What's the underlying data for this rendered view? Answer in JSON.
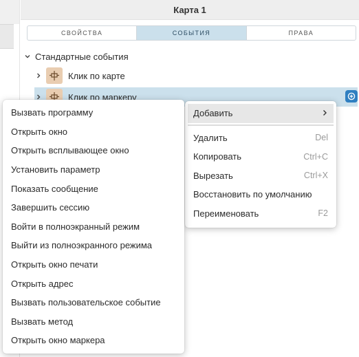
{
  "panel": {
    "title": "Карта 1",
    "tabs": [
      {
        "label": "Свойства",
        "active": false
      },
      {
        "label": "События",
        "active": true
      },
      {
        "label": "Права",
        "active": false
      }
    ]
  },
  "tree": {
    "group_label": "Стандартные события",
    "items": [
      {
        "label": "Клик по карте",
        "selected": false,
        "icon": "event-block-icon"
      },
      {
        "label": "Клик по маркеру",
        "selected": true,
        "icon": "event-block-icon"
      }
    ]
  },
  "context_menu": {
    "items": [
      {
        "label": "Добавить",
        "shortcut": "",
        "has_submenu": true
      },
      {
        "label": "Удалить",
        "shortcut": "Del"
      },
      {
        "label": "Копировать",
        "shortcut": "Ctrl+C"
      },
      {
        "label": "Вырезать",
        "shortcut": "Ctrl+X"
      },
      {
        "label": "Восстановить по умолчанию",
        "shortcut": ""
      },
      {
        "label": "Переименовать",
        "shortcut": "F2"
      }
    ]
  },
  "submenu": {
    "items": [
      "Вызвать программу",
      "Открыть окно",
      "Открыть всплывающее окно",
      "Установить параметр",
      "Показать сообщение",
      "Завершить сессию",
      "Войти в полноэкранный режим",
      "Выйти из полноэкранного режима",
      "Открыть окно печати",
      "Открыть адрес",
      "Вызвать пользовательское событие",
      "Вызвать метод",
      "Открыть окно маркера"
    ]
  },
  "colors": {
    "accent": "#2f7fc1",
    "selection": "#cbe0ec",
    "icon_bg": "#e9cdb1"
  }
}
